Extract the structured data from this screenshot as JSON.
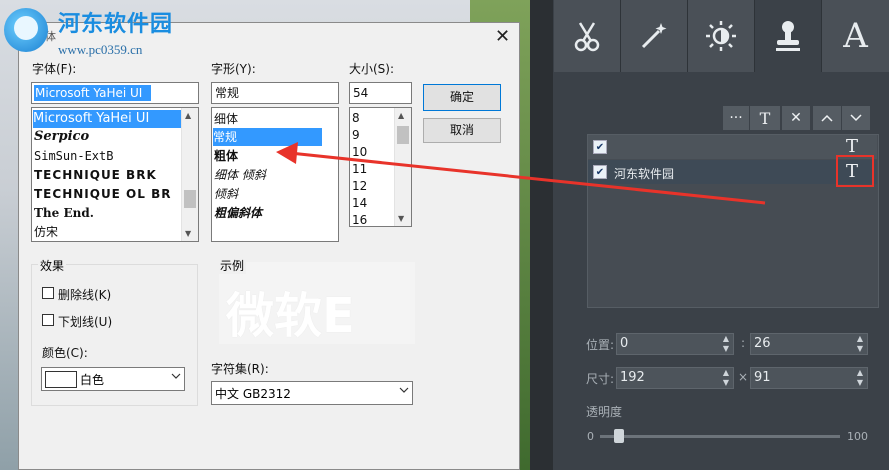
{
  "watermark": {
    "title": "河东软件园",
    "url": "www.pc0359.cn"
  },
  "dialog": {
    "title": "字体",
    "labels": {
      "font": "字体(F):",
      "style": "字形(Y):",
      "size": "大小(S):",
      "charset": "字符集(R):",
      "color": "颜色(C):"
    },
    "font_value": "Microsoft YaHei UI",
    "style_value": "常规",
    "size_value": "54",
    "font_list": [
      "Microsoft YaHei UI",
      "Serpico",
      "SimSun-ExtB",
      "TECHNIQUE BRK",
      "TECHNIQUE OL BR",
      "The End.",
      "仿宋"
    ],
    "style_list": [
      "细体",
      "常规",
      "粗体",
      "细体 倾斜",
      "倾斜",
      "粗偏斜体"
    ],
    "size_list": [
      "8",
      "9",
      "10",
      "11",
      "12",
      "14",
      "16"
    ],
    "ok_label": "确定",
    "cancel_label": "取消",
    "effects": {
      "title": "效果",
      "strikeout": "删除线(K)",
      "underline": "下划线(U)"
    },
    "color_value": "白色",
    "sample": {
      "title": "示例",
      "text": "微软E"
    },
    "charset_value": "中文 GB2312"
  },
  "right_panel": {
    "tabs": [
      {
        "name": "scissors-icon",
        "glyph": "✂"
      },
      {
        "name": "magic-wand-icon",
        "glyph": "⚚"
      },
      {
        "name": "brightness-icon",
        "glyph": "☀"
      },
      {
        "name": "stamp-icon",
        "glyph": "⚙"
      },
      {
        "name": "text-icon",
        "glyph": "A"
      }
    ],
    "toolbar": {
      "more": "···",
      "text": "T",
      "close": "✕",
      "up": "︿",
      "down": "﹀"
    },
    "layers": [
      {
        "label": "",
        "checked": true,
        "icon": "T"
      },
      {
        "label": "河东软件园",
        "checked": true,
        "icon": "T"
      }
    ],
    "position_label": "位置:",
    "size_label": "尺寸:",
    "opacity_label": "透明度",
    "pos_x": "0",
    "pos_y": "26",
    "size_w": "192",
    "size_h": "91",
    "pos_sep": ":",
    "size_sep": "×",
    "opacity_min": "0",
    "opacity_max": "100",
    "opacity_value": 0.08
  },
  "colors": {
    "accent": "#3399ff",
    "highlight": "#e8332a",
    "panel": "#3b4148"
  }
}
